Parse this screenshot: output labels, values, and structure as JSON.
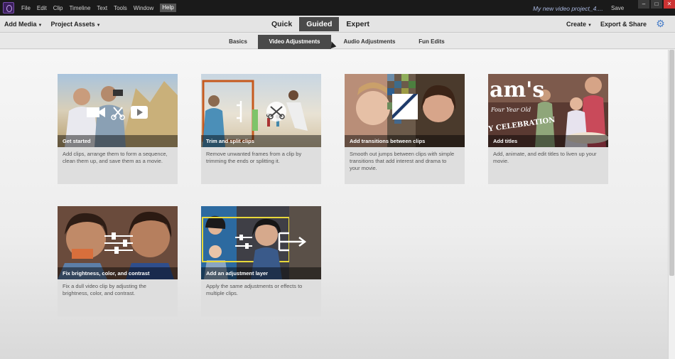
{
  "menu": [
    "File",
    "Edit",
    "Clip",
    "Timeline",
    "Text",
    "Tools",
    "Window",
    "Help"
  ],
  "project_name": "My new video project_4....",
  "save_label": "Save",
  "window_controls": [
    "–",
    "□",
    "✕"
  ],
  "toolbar": {
    "add_media": "Add Media",
    "project_assets": "Project Assets",
    "create": "Create",
    "export_share": "Export & Share"
  },
  "modes": [
    "Quick",
    "Guided",
    "Expert"
  ],
  "active_mode": "Guided",
  "subtabs": [
    "Basics",
    "Video Adjustments",
    "Audio Adjustments",
    "Fun Edits"
  ],
  "active_subtab": "Video Adjustments",
  "cards": [
    {
      "title": "Get started",
      "desc": "Add clips, arrange them to form a sequence, clean them up, and save them as a movie."
    },
    {
      "title": "Trim and split clips",
      "desc": "Remove unwanted frames from a clip by trimming the ends or splitting it."
    },
    {
      "title": "Add transitions between clips",
      "desc": "Smooth out jumps between clips with simple transitions that add interest and drama to your movie."
    },
    {
      "title": "Add titles",
      "desc": "Add, animate, and edit titles to liven up your movie."
    },
    {
      "title": "Fix brightness, color, and contrast",
      "desc": "Fix a dull video clip by adjusting the brightness, color, and contrast."
    },
    {
      "title": "Add an adjustment layer",
      "desc": "Apply the same adjustments or effects to multiple clips."
    }
  ],
  "thumb_text": {
    "titles_big": "am's",
    "titles_small": "Four Year Old",
    "titles_banner": "Y CELEBRATION"
  },
  "colors": {
    "accent": "#4a7fc9",
    "titlebar": "#1a1a1a",
    "active_tab": "#4a4a4a"
  }
}
